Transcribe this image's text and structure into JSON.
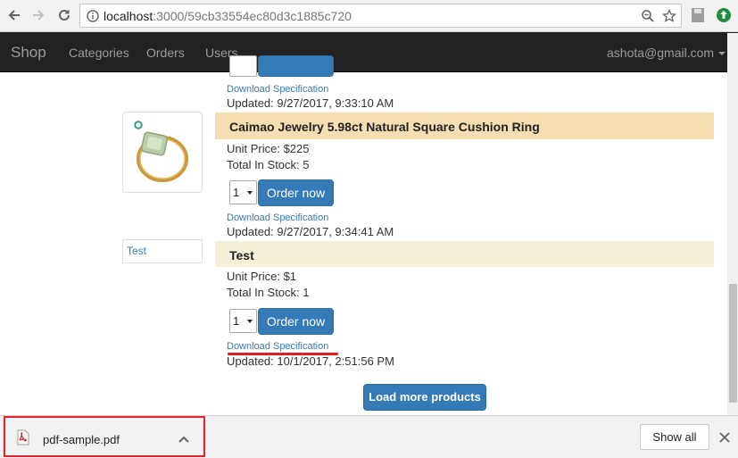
{
  "browser": {
    "url_host": "localhost",
    "url_path": ":3000/59cb33554ec80d3c1885c720"
  },
  "navbar": {
    "brand": "Shop",
    "links": [
      "Categories",
      "Orders",
      "Users"
    ],
    "user": "ashota@gmail.com"
  },
  "content": {
    "top_download_link": "Download Specification",
    "top_updated": "Updated: 9/27/2017, 9:33:10 AM",
    "products": [
      {
        "name": "Caimao Jewelry 5.98ct Natural Square Cushion Ring",
        "unit_price": "Unit Price: $225",
        "stock": "Total In Stock: 5",
        "qty": "1",
        "order_label": "Order now",
        "download_label": "Download Specification",
        "updated": "Updated: 9/27/2017, 9:34:41 AM",
        "header_color": "#f6deb3"
      },
      {
        "name": "Test",
        "thumb_label": "Test",
        "unit_price": "Unit Price: $1",
        "stock": "Total In Stock: 1",
        "qty": "1",
        "order_label": "Order now",
        "download_label": "Download Specification",
        "updated": "Updated: 10/1/2017, 2:51:56 PM",
        "header_color": "#f5f1d9"
      }
    ],
    "load_more": "Load more products"
  },
  "download_bar": {
    "file_name": "pdf-sample.pdf",
    "show_all": "Show all"
  },
  "colors": {
    "accent": "#337ab7",
    "navbar": "#222222",
    "highlight": "#e8202a"
  }
}
